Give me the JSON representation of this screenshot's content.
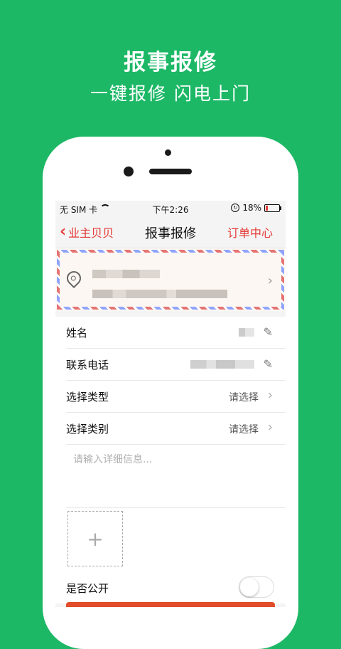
{
  "promo": {
    "title": "报事报修",
    "subtitle": "一键报修 闪电上门"
  },
  "status_bar": {
    "carrier": "无 SIM 卡",
    "time": "下午2:26",
    "battery": "18%",
    "battery_level": 0.18
  },
  "nav": {
    "back_label": "业主贝贝",
    "title": "报事报修",
    "right_label": "订单中心"
  },
  "form": {
    "name_label": "姓名",
    "phone_label": "联系电话",
    "type_label": "选择类型",
    "type_value": "请选择",
    "category_label": "选择类别",
    "category_value": "请选择",
    "details_placeholder": "请输入详细信息...",
    "add_photo": "+",
    "public_label": "是否公开",
    "public_on": false
  },
  "icons": {
    "back": "chevron-left-icon",
    "location": "location-pin-icon",
    "edit": "pencil-icon",
    "chevron": "chevron-right-icon",
    "wifi": "wifi-icon",
    "lock": "rotation-lock-icon",
    "battery": "battery-icon"
  },
  "colors": {
    "background": "#1db866",
    "accent": "#e53935",
    "submit": "#e14d2a"
  }
}
